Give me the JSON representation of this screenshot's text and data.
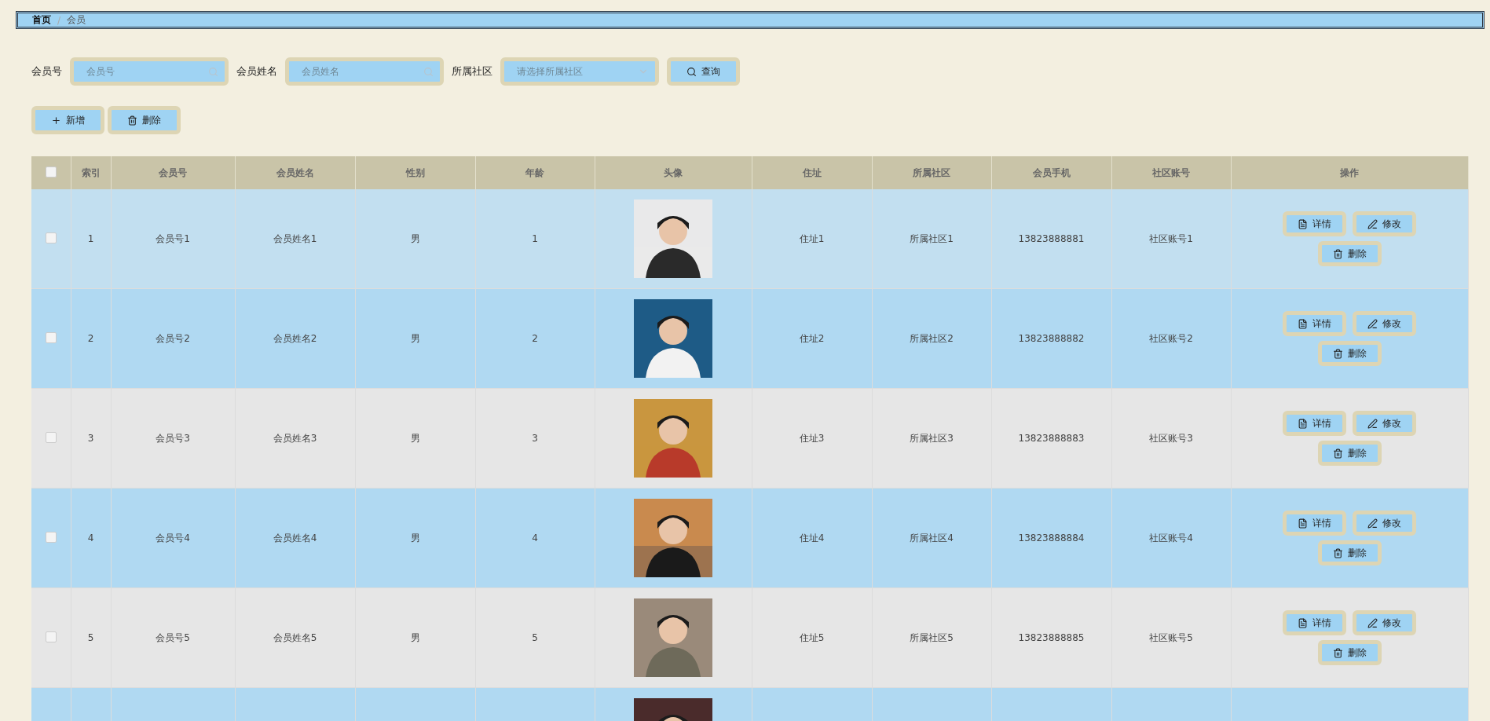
{
  "breadcrumb": {
    "separator": "/",
    "items": [
      {
        "label": "首页",
        "current": false
      },
      {
        "label": "会员",
        "current": true
      }
    ]
  },
  "search": {
    "fields": [
      {
        "label": "会员号",
        "kind": "text",
        "placeholder": "会员号"
      },
      {
        "label": "会员姓名",
        "kind": "text",
        "placeholder": "会员姓名"
      },
      {
        "label": "所属社区",
        "kind": "select",
        "placeholder": "请选择所属社区"
      }
    ],
    "button": "查询"
  },
  "actions": [
    {
      "kind": "add",
      "label": "新增"
    },
    {
      "kind": "delete",
      "label": "删除"
    }
  ],
  "table": {
    "all_checked": false,
    "columns": [
      "索引",
      "会员号",
      "会员姓名",
      "性别",
      "年龄",
      "头像",
      "住址",
      "所属社区",
      "会员手机",
      "社区账号",
      "操作"
    ],
    "rows": [
      {
        "checked": false,
        "hovered": true,
        "index": "1",
        "member_no": "会员号1",
        "name": "会员姓名1",
        "gender": "男",
        "age": "1",
        "address": "住址1",
        "community": "所属社区1",
        "phone": "13823888881",
        "account": "社区账号1",
        "buttons": [
          {
            "kind": "detail",
            "label": "详情"
          },
          {
            "kind": "edit",
            "label": "修改"
          },
          {
            "kind": "delete",
            "label": "删除"
          }
        ]
      },
      {
        "checked": false,
        "hovered": false,
        "index": "2",
        "member_no": "会员号2",
        "name": "会员姓名2",
        "gender": "男",
        "age": "2",
        "address": "住址2",
        "community": "所属社区2",
        "phone": "13823888882",
        "account": "社区账号2",
        "buttons": [
          {
            "kind": "detail",
            "label": "详情"
          },
          {
            "kind": "edit",
            "label": "修改"
          },
          {
            "kind": "delete",
            "label": "删除"
          }
        ]
      },
      {
        "checked": false,
        "hovered": false,
        "index": "3",
        "member_no": "会员号3",
        "name": "会员姓名3",
        "gender": "男",
        "age": "3",
        "address": "住址3",
        "community": "所属社区3",
        "phone": "13823888883",
        "account": "社区账号3",
        "buttons": [
          {
            "kind": "detail",
            "label": "详情"
          },
          {
            "kind": "edit",
            "label": "修改"
          },
          {
            "kind": "delete",
            "label": "删除"
          }
        ]
      },
      {
        "checked": false,
        "hovered": false,
        "index": "4",
        "member_no": "会员号4",
        "name": "会员姓名4",
        "gender": "男",
        "age": "4",
        "address": "住址4",
        "community": "所属社区4",
        "phone": "13823888884",
        "account": "社区账号4",
        "buttons": [
          {
            "kind": "detail",
            "label": "详情"
          },
          {
            "kind": "edit",
            "label": "修改"
          },
          {
            "kind": "delete",
            "label": "删除"
          }
        ]
      },
      {
        "checked": false,
        "hovered": false,
        "index": "5",
        "member_no": "会员号5",
        "name": "会员姓名5",
        "gender": "男",
        "age": "5",
        "address": "住址5",
        "community": "所属社区5",
        "phone": "13823888885",
        "account": "社区账号5",
        "buttons": [
          {
            "kind": "detail",
            "label": "详情"
          },
          {
            "kind": "edit",
            "label": "修改"
          },
          {
            "kind": "delete",
            "label": "删除"
          }
        ]
      },
      {
        "hovered": false
      }
    ]
  }
}
